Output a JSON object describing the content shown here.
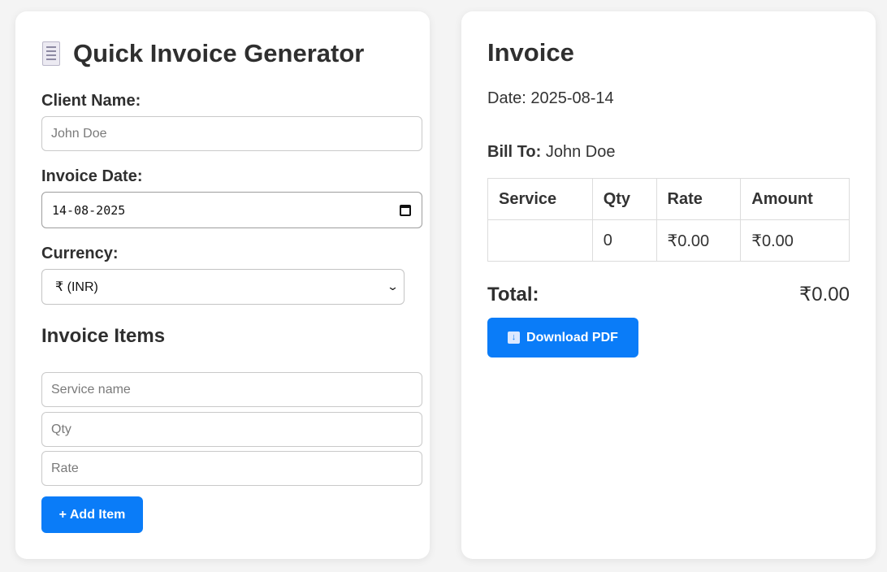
{
  "form": {
    "title": "Quick Invoice Generator",
    "title_icon": "receipt-icon",
    "client_label": "Client Name:",
    "client_placeholder": "John Doe",
    "date_label": "Invoice Date:",
    "date_value": "14-08-2025",
    "currency_label": "Currency:",
    "currency_value": "₹ (INR)",
    "items_heading": "Invoice Items",
    "service_placeholder": "Service name",
    "qty_placeholder": "Qty",
    "rate_placeholder": "Rate",
    "add_button": "+ Add Item"
  },
  "invoice": {
    "title": "Invoice",
    "date_text": "Date: 2025-08-14",
    "bill_to_label": "Bill To:",
    "bill_to_name": "John Doe",
    "columns": [
      "Service",
      "Qty",
      "Rate",
      "Amount"
    ],
    "rows": [
      {
        "service": "",
        "qty": "0",
        "rate": "₹0.00",
        "amount": "₹0.00"
      }
    ],
    "total_label": "Total:",
    "total_value": "₹0.00",
    "download_button": "Download PDF",
    "download_icon": "download-icon"
  },
  "colors": {
    "accent": "#0a7cf8",
    "background": "#f4f4f4",
    "card": "#ffffff"
  }
}
